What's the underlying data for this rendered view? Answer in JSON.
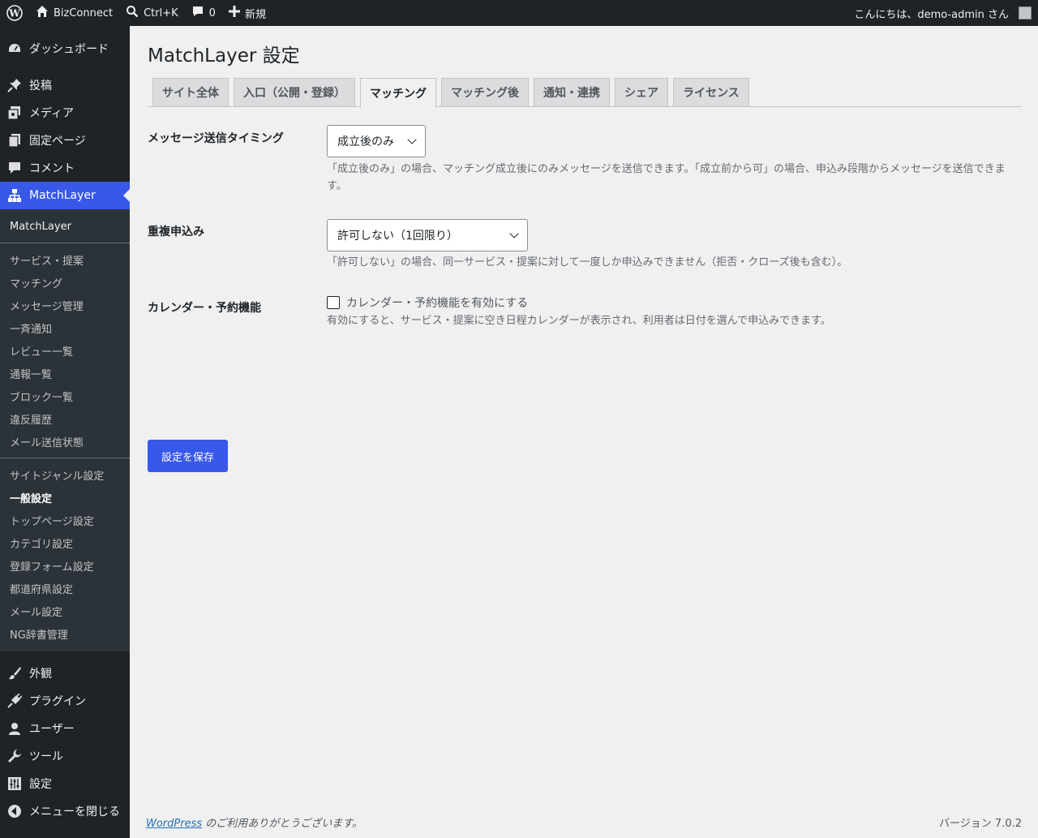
{
  "adminbar": {
    "site_name": "BizConnect",
    "search_shortcut": "Ctrl+K",
    "comments_count": "0",
    "new_label": "新規",
    "greeting": "こんにちは、demo-admin さん"
  },
  "sidebar": {
    "dashboard": "ダッシュボード",
    "posts": "投稿",
    "media": "メディア",
    "pages": "固定ページ",
    "comments": "コメント",
    "matchlayer": "MatchLayer",
    "sub_head": "MatchLayer",
    "sub_group1": [
      "サービス・提案",
      "マッチング",
      "メッセージ管理",
      "一斉通知",
      "レビュー一覧",
      "通報一覧",
      "ブロック一覧",
      "違反履歴",
      "メール送信状態"
    ],
    "sub_group2": [
      "サイトジャンル設定",
      "一般設定",
      "トップページ設定",
      "カテゴリ設定",
      "登録フォーム設定",
      "都道府県設定",
      "メール設定",
      "NG辞書管理"
    ],
    "appearance": "外観",
    "plugins": "プラグイン",
    "users": "ユーザー",
    "tools": "ツール",
    "settings": "設定",
    "collapse": "メニューを閉じる"
  },
  "main": {
    "title": "MatchLayer 設定",
    "tabs": [
      "サイト全体",
      "入口（公開・登録）",
      "マッチング",
      "マッチング後",
      "通知・連携",
      "シェア",
      "ライセンス"
    ],
    "message_timing": {
      "label": "メッセージ送信タイミング",
      "value": "成立後のみ",
      "description": "「成立後のみ」の場合、マッチング成立後にのみメッセージを送信できます。「成立前から可」の場合、申込み段階からメッセージを送信できます。"
    },
    "duplicate": {
      "label": "重複申込み",
      "value": "許可しない（1回限り）",
      "description": "「許可しない」の場合、同一サービス・提案に対して一度しか申込みできません（拒否・クローズ後も含む）。"
    },
    "calendar": {
      "label": "カレンダー・予約機能",
      "checkbox_label": "カレンダー・予約機能を有効にする",
      "checked": false,
      "description": "有効にすると、サービス・提案に空き日程カレンダーが表示され、利用者は日付を選んで申込みできます。"
    },
    "save_button": "設定を保存"
  },
  "footer": {
    "wordpress_link": "WordPress",
    "thanks": " のご利用ありがとうございます。",
    "version": "バージョン 7.0.2"
  }
}
